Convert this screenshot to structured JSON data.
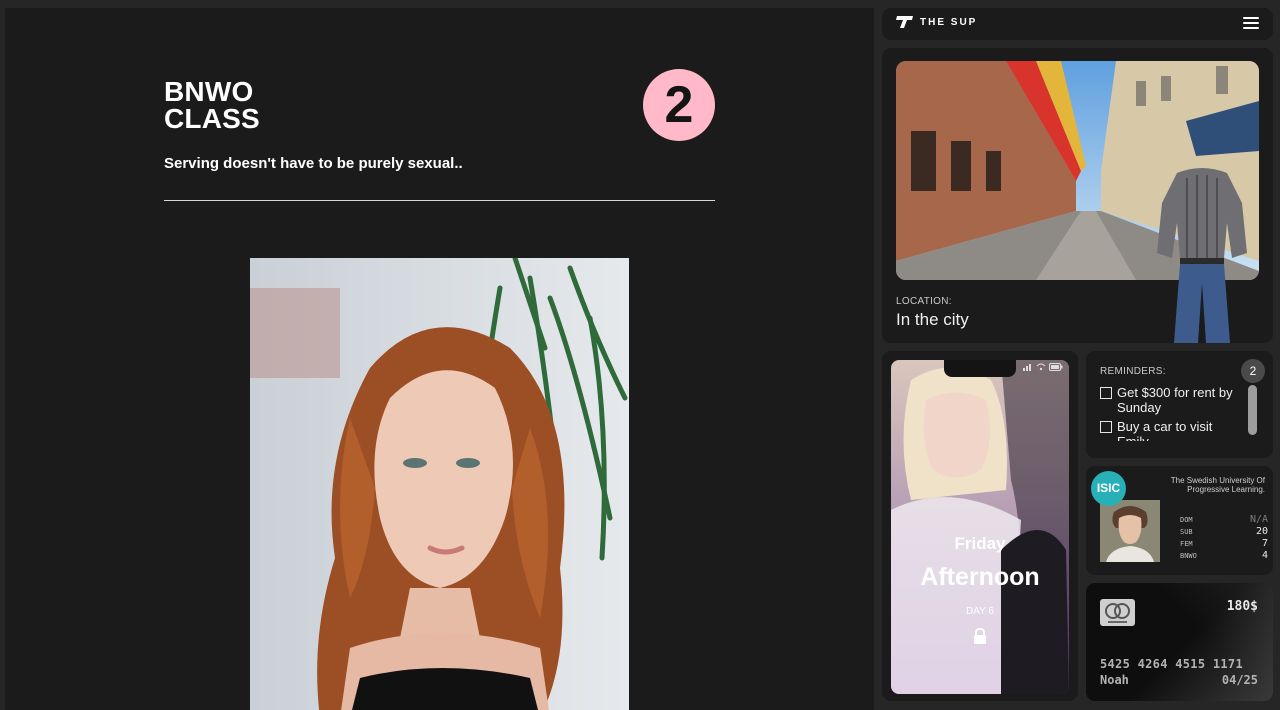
{
  "main": {
    "title_line1": "BNWO",
    "title_line2": "CLASS",
    "class_number": "2",
    "subtitle": "Serving doesn't have to be purely sexual.."
  },
  "header": {
    "logo_text": "THE SUP",
    "menu_icon": "hamburger-menu-icon"
  },
  "location": {
    "label": "LOCATION:",
    "value": "In the city"
  },
  "phone": {
    "day": "Friday",
    "time_of_day": "Afternoon",
    "day_number": "DAY 6",
    "lock_icon": "lock-icon"
  },
  "reminders": {
    "label": "REMINDERS:",
    "count": "2",
    "items": [
      {
        "text": "Get $300 for rent by Sunday",
        "checked": false
      },
      {
        "text": "Buy a car to visit Emily",
        "checked": false
      }
    ]
  },
  "id_card": {
    "badge": "ISIC",
    "university": "The Swedish University Of Progressive Learning.",
    "stats": [
      {
        "label": "DOM",
        "value": "N/A"
      },
      {
        "label": "SUB",
        "value": "20"
      },
      {
        "label": "FEM",
        "value": "7"
      },
      {
        "label": "BNWO",
        "value": "4"
      }
    ]
  },
  "credit_card": {
    "balance": "180$",
    "number": "5425 4264 4515 1171",
    "holder": "Noah",
    "expiry": "04/25",
    "brand_icon": "mastercard-icon"
  },
  "colors": {
    "accent_pink": "#ffb9c9",
    "isic_teal": "#27b0b8",
    "panel_bg": "#1b1b1b",
    "page_bg": "#262626"
  }
}
